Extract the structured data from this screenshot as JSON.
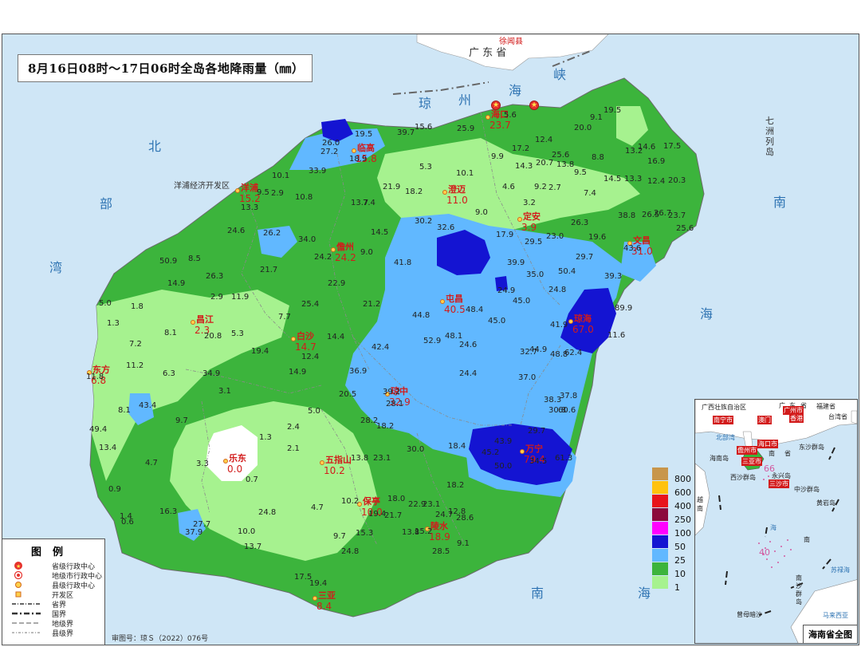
{
  "title": "8月16日08时～17日06时全岛各地降雨量（㎜）",
  "map_number": "审图号：琼Ｓ（2022）076号",
  "sea_labels": {
    "qiongzhou_strait": [
      "琼",
      "州",
      "海",
      "峡"
    ],
    "beibu_gulf": [
      "北",
      "部",
      "湾"
    ],
    "south_sea": [
      "南",
      "海"
    ],
    "south_china_sea_bottom": [
      "南",
      "海"
    ],
    "qizhou_islands": "七洲列岛"
  },
  "land_labels": {
    "guangdong": "广 东 省",
    "xuwen": "徐闻县",
    "yangpu": "洋浦经济开发区"
  },
  "cities": [
    {
      "name": "海口",
      "value": "23.7"
    },
    {
      "name": "临高",
      "value": "15.8"
    },
    {
      "name": "澄迈",
      "value": "11.0"
    },
    {
      "name": "定安",
      "value": "3.9"
    },
    {
      "name": "文昌",
      "value": "31.0"
    },
    {
      "name": "儋州",
      "value": "24.2"
    },
    {
      "name": "屯昌",
      "value": "40.5"
    },
    {
      "name": "琼海",
      "value": "67.0"
    },
    {
      "name": "昌江",
      "value": "2.3"
    },
    {
      "name": "白沙",
      "value": "14.7"
    },
    {
      "name": "东方",
      "value": "6.8"
    },
    {
      "name": "琼中",
      "value": "32.9"
    },
    {
      "name": "万宁",
      "value": "79.4"
    },
    {
      "name": "乐东",
      "value": "0.0"
    },
    {
      "name": "五指山",
      "value": "10.2"
    },
    {
      "name": "保亭",
      "value": "10.0"
    },
    {
      "name": "陵水",
      "value": "18.9"
    },
    {
      "name": "三亚",
      "value": "8.4"
    },
    {
      "name": "洋浦",
      "value": "15.2"
    }
  ],
  "station_values": [
    "19.5",
    "9.1",
    "5.6",
    "20.0",
    "12.4",
    "17.2",
    "25.6",
    "8.8",
    "13.2",
    "14.6",
    "17.5",
    "16.9",
    "14.3",
    "20.7",
    "13.8",
    "9.9",
    "9.5",
    "14.5",
    "13.3",
    "12.4",
    "20.3",
    "39.7",
    "15.6",
    "25.9",
    "19.5",
    "26.0",
    "27.2",
    "18.9",
    "5.3",
    "10.1",
    "4.6",
    "9.2",
    "2.7",
    "7.4",
    "33.9",
    "10.1",
    "21.9",
    "18.2",
    "9.5",
    "2.9",
    "10.8",
    "13.3",
    "13.7",
    "7.4",
    "9.0",
    "3.2",
    "38.8",
    "26.5",
    "26.7",
    "23.7",
    "25.6",
    "24.6",
    "26.2",
    "34.0",
    "14.5",
    "30.2",
    "32.6",
    "17.9",
    "29.5",
    "23.0",
    "19.6",
    "26.3",
    "50.9",
    "8.5",
    "24.2",
    "9.0",
    "41.8",
    "39.9",
    "29.7",
    "43.6",
    "26.3",
    "21.7",
    "35.0",
    "50.4",
    "39.3",
    "14.9",
    "22.9",
    "24.9",
    "45.0",
    "48.4",
    "24.8",
    "5.0",
    "1.8",
    "2.9",
    "11.9",
    "25.4",
    "21.2",
    "44.8",
    "45.0",
    "89.9",
    "1.3",
    "7.7",
    "41.9",
    "7.2",
    "8.1",
    "20.8",
    "5.3",
    "14.4",
    "52.9",
    "48.1",
    "24.6",
    "11.6",
    "19.4",
    "42.4",
    "32.7",
    "44.9",
    "48.8",
    "62.4",
    "12.4",
    "11.2",
    "6.3",
    "34.9",
    "14.9",
    "36.9",
    "24.4",
    "37.0",
    "11.8",
    "3.1",
    "20.5",
    "39.2",
    "38.3",
    "37.8",
    "8.1",
    "43.4",
    "28.1",
    "30.8",
    "60.6",
    "9.7",
    "5.0",
    "28.2",
    "49.4",
    "2.4",
    "18.2",
    "29.7",
    "13.4",
    "1.3",
    "2.1",
    "30.0",
    "18.4",
    "43.9",
    "45.2",
    "4.7",
    "3.3",
    "13.8",
    "23.1",
    "50.0",
    "61.3",
    "34.5",
    "0.7",
    "18.2",
    "0.9",
    "18.0",
    "22.9",
    "23.1",
    "16.3",
    "24.8",
    "4.7",
    "10.2",
    "19.4",
    "21.7",
    "24.7",
    "12.8",
    "28.6",
    "1.4",
    "0.6",
    "27.7",
    "37.9",
    "10.0",
    "9.7",
    "15.3",
    "13.8",
    "15.2",
    "28.5",
    "9.1",
    "13.7",
    "24.8",
    "17.5",
    "19.4"
  ],
  "color_scale": [
    {
      "label": "800",
      "color": "#c8964b"
    },
    {
      "label": "600",
      "color": "#ffc20e"
    },
    {
      "label": "400",
      "color": "#e8141b"
    },
    {
      "label": "250",
      "color": "#8c0a3c"
    },
    {
      "label": "100",
      "color": "#ff00ff"
    },
    {
      "label": "50",
      "color": "#1414d2"
    },
    {
      "label": "25",
      "color": "#61b8ff"
    },
    {
      "label": "10",
      "color": "#3cb43c"
    },
    {
      "label": "1",
      "color": "#a6f28f"
    }
  ],
  "symbol_legend": {
    "title": "图例",
    "items": [
      "省级行政中心",
      "地级市行政中心",
      "县级行政中心",
      "开发区",
      "省界",
      "国界",
      "地级界",
      "县级界"
    ]
  },
  "inset": {
    "title": "海南省全图",
    "labels": [
      "广西壮族自治区",
      "广",
      "东",
      "省",
      "福建省",
      "台湾省",
      "南宁市",
      "澳门",
      "香港",
      "广州市",
      "海口市",
      "北部湾",
      "南",
      "省",
      "东沙群岛",
      "海南岛",
      "儋州市",
      "三亚市",
      "西沙群岛",
      "永兴岛",
      "三沙市",
      "中沙群岛",
      "黄岩岛",
      "海",
      "南",
      "苏禄海",
      "曾母暗沙",
      "马来西亚",
      "越南",
      "南",
      "沙",
      "群",
      "岛"
    ],
    "numbers": [
      "66",
      "40"
    ]
  }
}
